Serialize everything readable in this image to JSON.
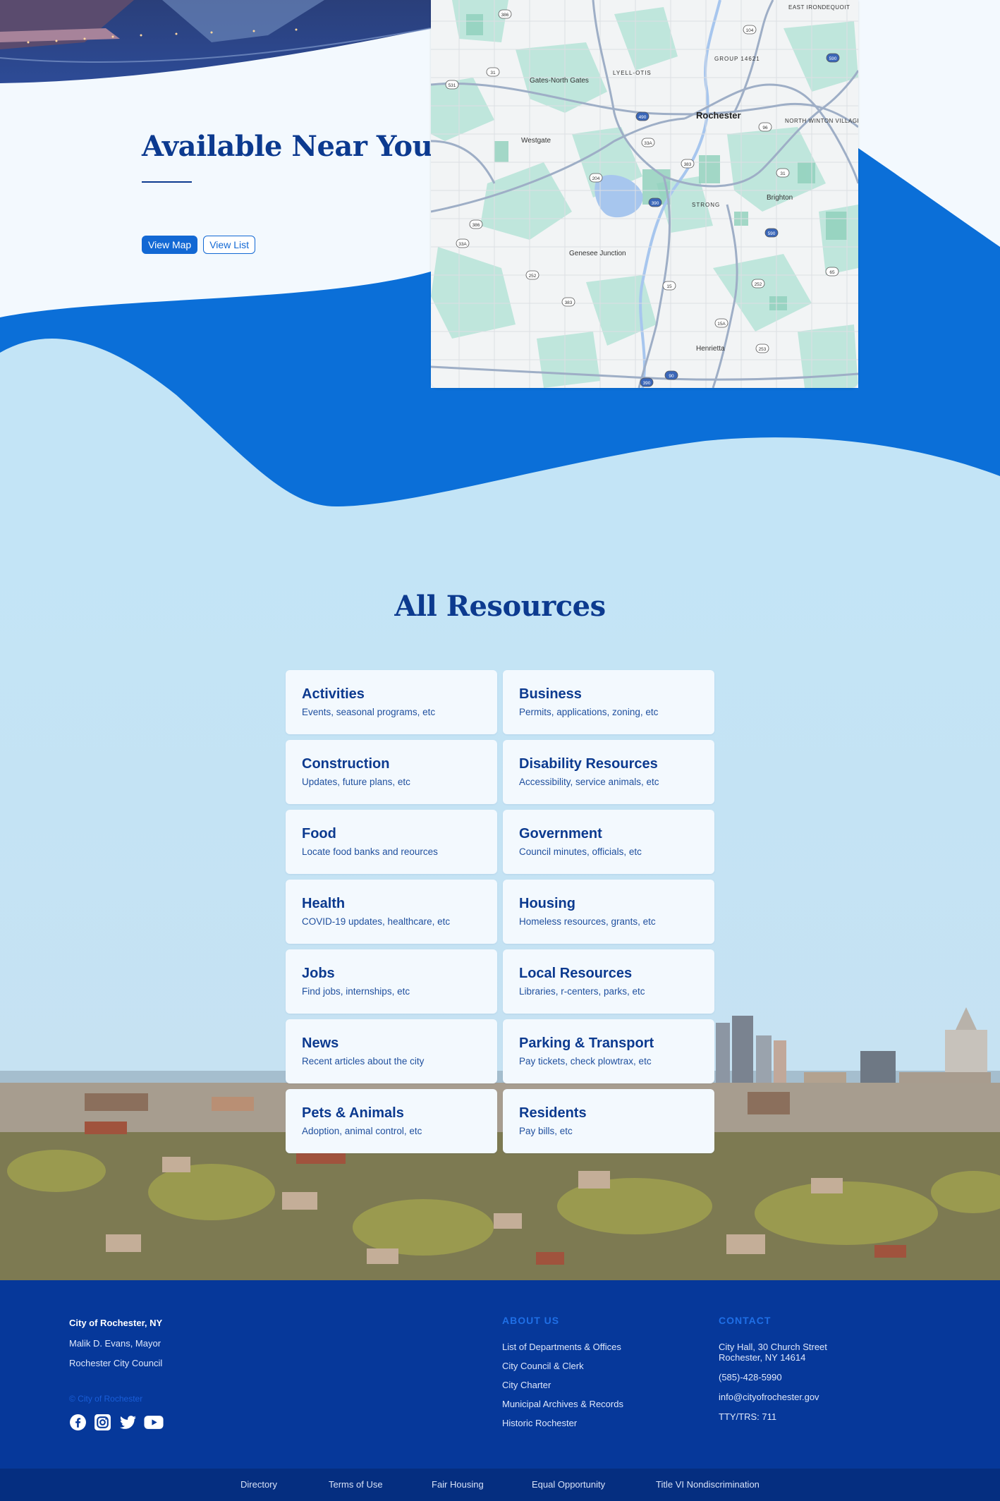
{
  "near_you": {
    "title": "Available Near You",
    "view_map_label": "View Map",
    "view_list_label": "View List"
  },
  "map": {
    "labels": [
      {
        "text": "Rochester"
      },
      {
        "text": "GROUP 14621"
      },
      {
        "text": "LYELL-OTIS"
      },
      {
        "text": "Gates-North Gates"
      },
      {
        "text": "Westgate"
      },
      {
        "text": "NORTH WINTON VILLAGE"
      },
      {
        "text": "EAST IRONDEQUOIT"
      },
      {
        "text": "STRONG"
      },
      {
        "text": "Brighton"
      },
      {
        "text": "Genesee Junction"
      },
      {
        "text": "Henrietta"
      }
    ],
    "route_shields": [
      "386",
      "104",
      "590",
      "31",
      "531",
      "490",
      "33A",
      "383",
      "204",
      "390",
      "590",
      "386",
      "33A",
      "252",
      "383",
      "15",
      "252",
      "15A",
      "253",
      "65",
      "96",
      "31",
      "390",
      "90"
    ]
  },
  "resources": {
    "title": "All Resources",
    "items": [
      {
        "title": "Activities",
        "desc": "Events, seasonal programs, etc"
      },
      {
        "title": "Business",
        "desc": "Permits, applications, zoning, etc"
      },
      {
        "title": "Construction",
        "desc": "Updates, future plans, etc"
      },
      {
        "title": "Disability Resources",
        "desc": "Accessibility, service animals, etc"
      },
      {
        "title": "Food",
        "desc": "Locate food banks and reources"
      },
      {
        "title": "Government",
        "desc": "Council minutes, officials, etc"
      },
      {
        "title": "Health",
        "desc": "COVID-19 updates, healthcare, etc"
      },
      {
        "title": "Housing",
        "desc": "Homeless resources, grants, etc"
      },
      {
        "title": "Jobs",
        "desc": "Find jobs, internships, etc"
      },
      {
        "title": "Local Resources",
        "desc": "Libraries, r-centers, parks, etc"
      },
      {
        "title": "News",
        "desc": "Recent articles about the city"
      },
      {
        "title": "Parking & Transport",
        "desc": "Pay tickets, check plowtrax, etc"
      },
      {
        "title": "Pets & Animals",
        "desc": "Adoption, animal control, etc"
      },
      {
        "title": "Residents",
        "desc": "Pay bills, etc"
      }
    ]
  },
  "footer": {
    "org_name": "City of Rochester, NY",
    "mayor": "Malik D. Evans, Mayor",
    "council": "Rochester City Council",
    "copyright": "© City of Rochester",
    "social_icons": [
      "facebook-icon",
      "instagram-icon",
      "twitter-icon",
      "youtube-icon"
    ],
    "about_heading": "ABOUT US",
    "about_links": [
      "List of Departments & Offices",
      "City Council & Clerk",
      "City Charter",
      "Municipal Archives & Records",
      "Historic Rochester"
    ],
    "contact_heading": "CONTACT",
    "address_line1": "City Hall, 30 Church Street",
    "address_line2": "Rochester, NY 14614",
    "phone": "(585)-428-5990",
    "email": "info@cityofrochester.gov",
    "tty": "TTY/TRS: 711"
  },
  "legal_links": [
    "Directory",
    "Terms of Use",
    "Fair Housing",
    "Equal Opportunity",
    "Title VI Nondiscrimination"
  ],
  "colors": {
    "navy": "#0c3a8f",
    "primary_blue": "#1268d4",
    "light_sky": "#c3e4f6",
    "footer_bg": "#06389a",
    "legal_bg": "#052e80"
  }
}
